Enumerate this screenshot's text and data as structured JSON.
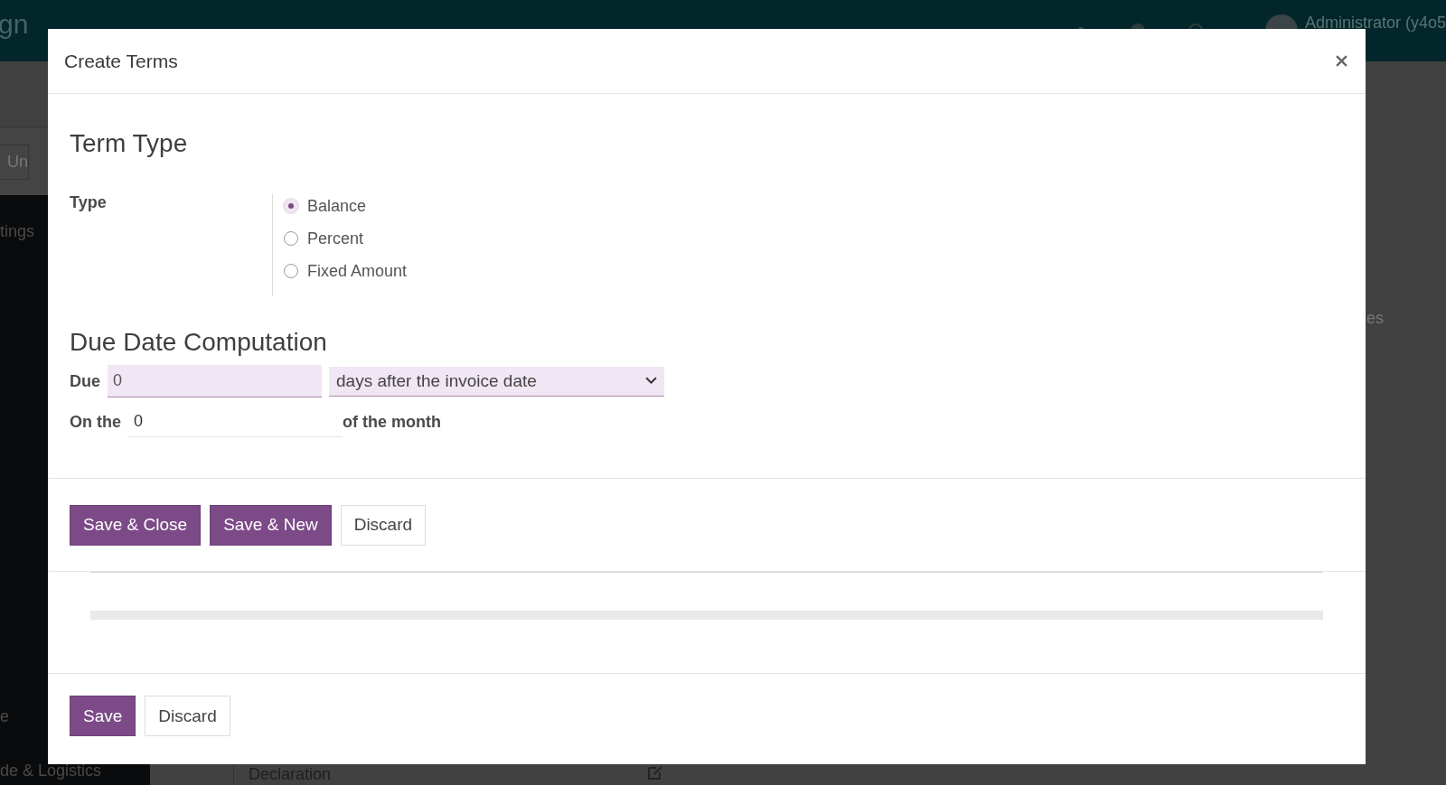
{
  "background": {
    "app_title": "gn",
    "user": "Administrator (y4o5",
    "toolbar_fragment": "Un",
    "sidebar": [
      "tings",
      "e",
      "de & Logistics"
    ],
    "side_text": "es",
    "row_text": "Declaration"
  },
  "dialog": {
    "title": "Create Terms",
    "term_heading": "Term Type",
    "type_label": "Type",
    "types": [
      {
        "label": "Balance",
        "selected": true
      },
      {
        "label": "Percent",
        "selected": false
      },
      {
        "label": "Fixed Amount",
        "selected": false
      }
    ],
    "due_heading": "Due Date Computation",
    "due": {
      "label": "Due",
      "value": "0",
      "option": "days after the invoice date"
    },
    "on_the": {
      "label": "On the",
      "value": "0",
      "suffix": "of the month"
    },
    "actions": [
      {
        "label": "Save & Close",
        "kind": "primary"
      },
      {
        "label": "Save & New",
        "kind": "primary"
      },
      {
        "label": "Discard",
        "kind": "secondary"
      }
    ],
    "footer": [
      {
        "label": "Save",
        "kind": "primary"
      },
      {
        "label": "Discard",
        "kind": "secondary"
      }
    ]
  }
}
